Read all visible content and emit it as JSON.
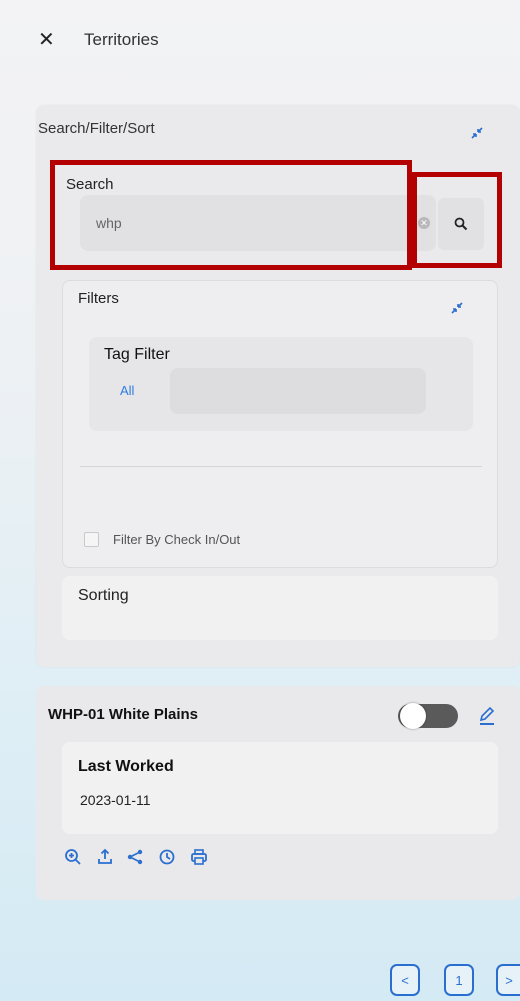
{
  "header": {
    "close_icon": "close-icon",
    "title": "Territories"
  },
  "search_filter_sort": {
    "title": "Search/Filter/Sort",
    "search": {
      "label": "Search",
      "value": "whp"
    },
    "filters": {
      "label": "Filters",
      "tag_filter": {
        "label": "Tag Filter",
        "all_label": "All"
      },
      "check_in_out_label": "Filter By Check In/Out",
      "check_in_out_checked": false
    },
    "sorting": {
      "label": "Sorting"
    }
  },
  "territory": {
    "title": "WHP-01 White Plains",
    "toggle_on": false,
    "last_worked_label": "Last Worked",
    "last_worked_date": "2023-01-11",
    "actions": [
      "zoom-in-icon",
      "export-icon",
      "share-icon",
      "history-icon",
      "print-icon"
    ]
  },
  "pagination": {
    "prev": "<",
    "page": "1",
    "next": ">"
  },
  "colors": {
    "accent": "#2a6fd0",
    "highlight": "#b30000"
  }
}
